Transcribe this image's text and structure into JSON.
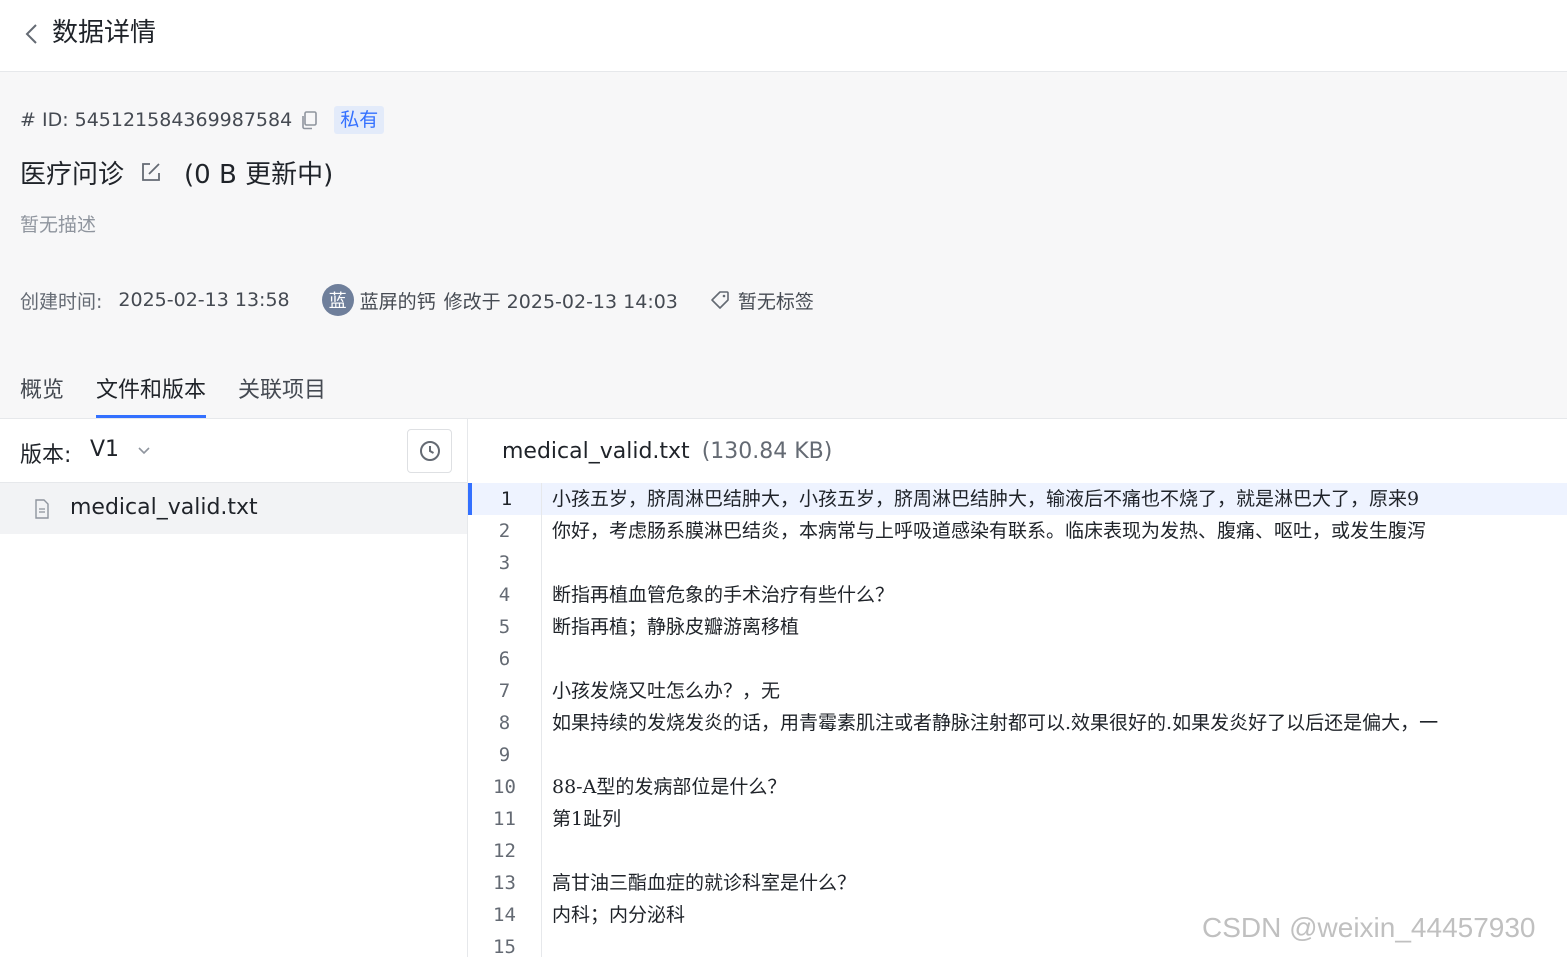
{
  "topbar": {
    "title": "数据详情"
  },
  "dataset": {
    "id_label": "# ID:",
    "id": "545121584369987584",
    "visibility": "私有",
    "name": "医疗问诊",
    "status": "(0 B 更新中)",
    "description": "暂无描述",
    "created_label": "创建时间:",
    "created_at": "2025-02-13 13:58",
    "avatar_char": "蓝",
    "user": "蓝屏的钙",
    "modified": "修改于 2025-02-13 14:03",
    "tags": "暂无标签"
  },
  "tabs": [
    "概览",
    "文件和版本",
    "关联项目"
  ],
  "version": {
    "label": "版本:",
    "value": "V1"
  },
  "files": [
    {
      "name": "medical_valid.txt"
    }
  ],
  "viewer": {
    "file_name": "medical_valid.txt",
    "file_size": "(130.84 KB)",
    "lines": [
      "小孩五岁，脐周淋巴结肿大，小孩五岁，脐周淋巴结肿大，输液后不痛也不烧了，就是淋巴大了，原来9",
      "你好，考虑肠系膜淋巴结炎，本病常与上呼吸道感染有联系。临床表现为发热、腹痛、呕吐，或发生腹泻",
      "",
      "断指再植血管危象的手术治疗有些什么？",
      "断指再植；静脉皮瓣游离移植",
      "",
      "小孩发烧又吐怎么办？，无",
      "如果持续的发烧发炎的话，用青霉素肌注或者静脉注射都可以.效果很好的.如果发炎好了以后还是偏大，一",
      "",
      "88-A型的发病部位是什么？",
      "第1趾列",
      "",
      "高甘油三酯血症的就诊科室是什么？",
      "内科；内分泌科",
      ""
    ]
  },
  "watermark": "CSDN @weixin_44457930",
  "colors": {
    "accent": "#3370ff",
    "badge_bg": "#e3ebfa",
    "header_bg": "#f7f7f8"
  }
}
